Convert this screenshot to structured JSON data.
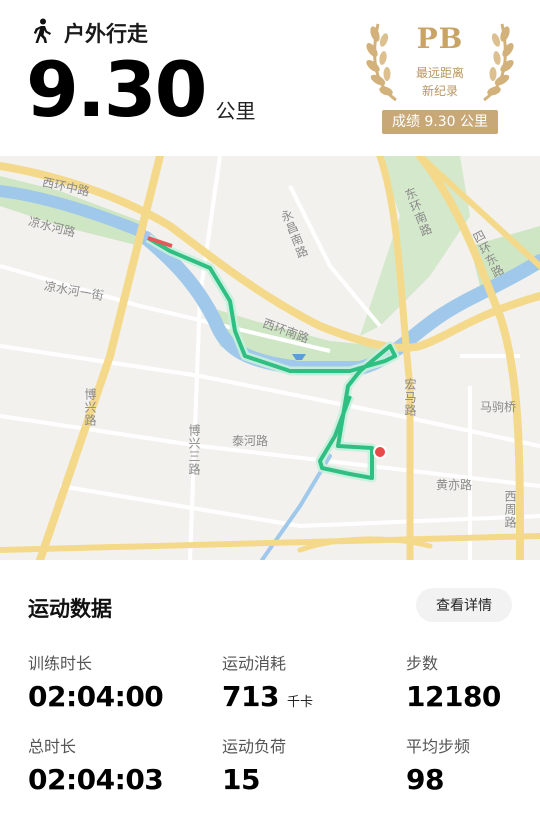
{
  "header": {
    "activity_icon": "walking-person-icon",
    "activity_label": "户外行走",
    "distance_value": "9.30",
    "distance_unit": "公里"
  },
  "pb_badge": {
    "title": "PB",
    "line1": "最远距离",
    "line2": "新纪录",
    "result": "成绩 9.30 公里",
    "color": "#c9a464"
  },
  "map": {
    "labels": [
      "西环中路",
      "凉水河路",
      "凉水河一街",
      "博兴路",
      "博兴三路",
      "泰河路",
      "西环南路",
      "永昌南路",
      "东环南路",
      "四环东路",
      "宏马路",
      "马驹桥",
      "黄亦路",
      "西周路"
    ],
    "route_color": "#2fbf83",
    "water_color": "#9fc8ea",
    "road_color": "#f5d98a"
  },
  "stats": {
    "title": "运动数据",
    "detail_button": "查看详情",
    "items": [
      {
        "label": "训练时长",
        "value": "02:04:00",
        "unit": ""
      },
      {
        "label": "运动消耗",
        "value": "713",
        "unit": "千卡"
      },
      {
        "label": "步数",
        "value": "12180",
        "unit": ""
      },
      {
        "label": "总时长",
        "value": "02:04:03",
        "unit": ""
      },
      {
        "label": "运动负荷",
        "value": "15",
        "unit": ""
      },
      {
        "label": "平均步频",
        "value": "98",
        "unit": ""
      }
    ]
  }
}
